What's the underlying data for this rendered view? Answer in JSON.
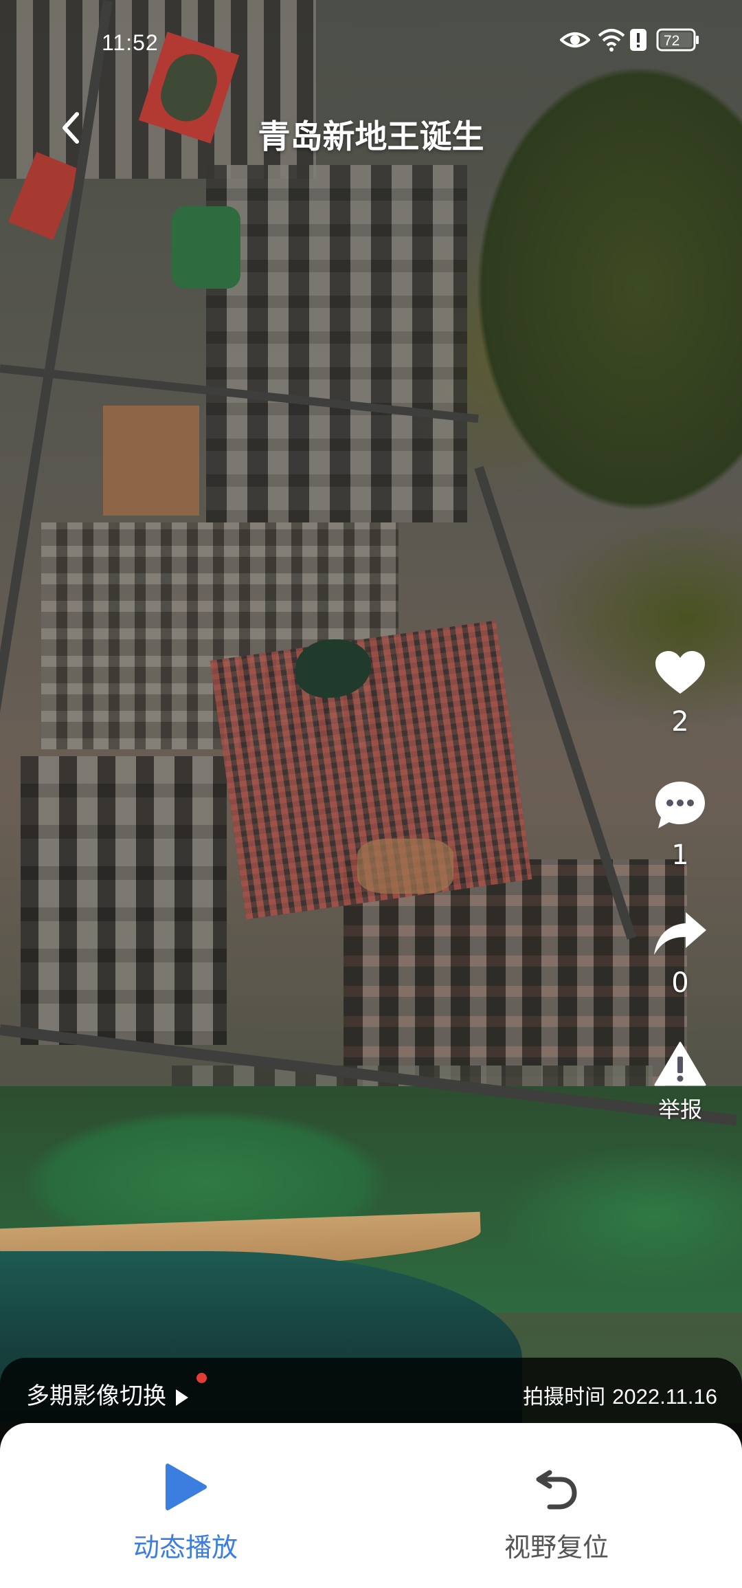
{
  "status_bar": {
    "time": "11:52",
    "battery": "72",
    "icons": [
      "eye-icon",
      "wifi-icon",
      "alert-icon",
      "battery-icon"
    ]
  },
  "header": {
    "title": "青岛新地王诞生",
    "back_icon": "chevron-left-icon"
  },
  "actions": {
    "like": {
      "icon": "heart-icon",
      "count": "2"
    },
    "comment": {
      "icon": "comment-icon",
      "count": "1"
    },
    "share": {
      "icon": "share-icon",
      "count": "0"
    },
    "report": {
      "icon": "warning-icon",
      "label": "举报"
    }
  },
  "info_bar": {
    "switch_label": "多期影像切换",
    "capture_label": "拍摄时间",
    "capture_date": "2022.11.16"
  },
  "bottom_panel": {
    "play": {
      "icon": "play-icon",
      "label": "动态播放",
      "color": "#3c7ee0"
    },
    "reset": {
      "icon": "undo-icon",
      "label": "视野复位",
      "color": "#555555"
    }
  },
  "colors": {
    "accent": "#3c7ee0",
    "notification_dot": "#e53b35"
  }
}
